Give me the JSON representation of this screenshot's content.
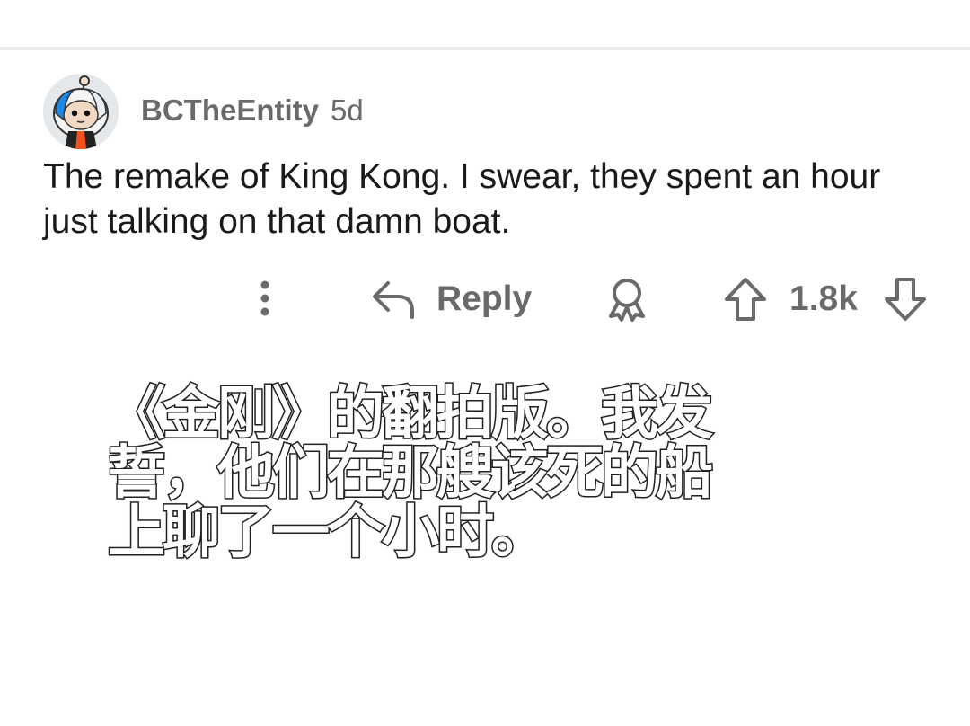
{
  "comment": {
    "author": "BCTheEntity",
    "age": "5d",
    "body": "The remake of King Kong. I swear, they spent an hour just talking on that damn boat.",
    "actions": {
      "more_icon": "vertical-ellipsis-icon",
      "reply_icon": "reply-arrow-icon",
      "reply_label": "Reply",
      "award_icon": "award-ribbon-icon",
      "upvote_icon": "upvote-arrow-icon",
      "score": "1.8k",
      "downvote_icon": "downvote-arrow-icon"
    }
  },
  "subtitle": {
    "text": "《金刚》的翻拍版。我发誓，他们在那艘该死的船上聊了一个小时。"
  },
  "colors": {
    "background": "#ffffff",
    "divider": "#ededed",
    "meta_text": "#6a6a6a",
    "body_text": "#1a1a1b",
    "avatar_bg": "#e5e8ea",
    "avatar_accent": "#1e88e5",
    "subtitle_fill": "#ffffff",
    "subtitle_stroke": "#222222"
  }
}
